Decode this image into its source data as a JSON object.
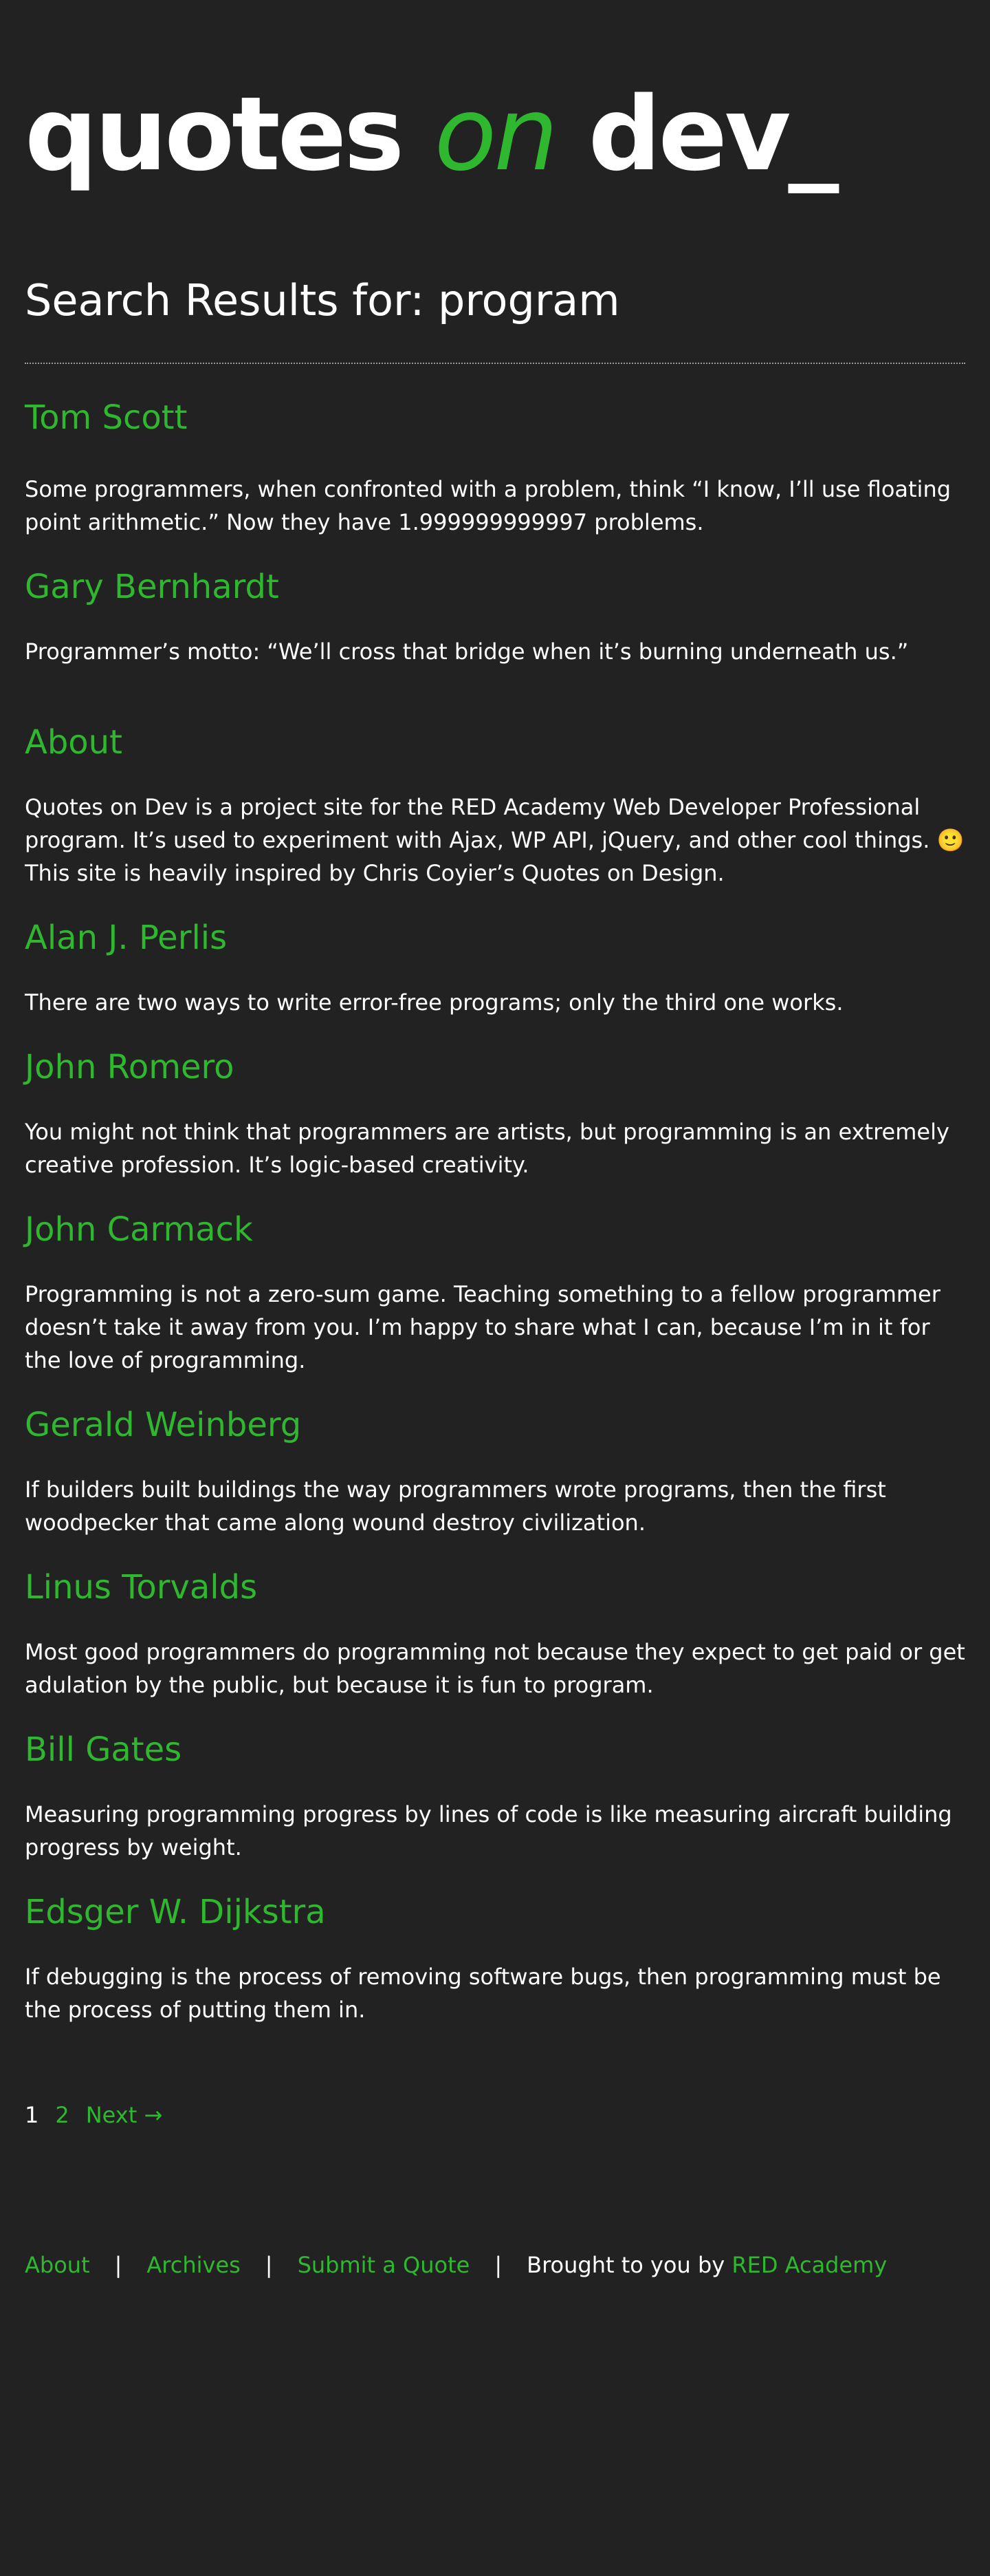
{
  "brand": {
    "logo_part1": "quotes ",
    "logo_part2": "on",
    "logo_part3": " dev_",
    "accent_color": "#2fb82f",
    "background_color": "#222222"
  },
  "search": {
    "title": "Search Results for: program"
  },
  "entries": [
    {
      "author": "Tom Scott",
      "text": "Some programmers, when confronted with a problem, think “I know, I’ll use floating point arithmetic.” Now they have 1.999999999997 problems."
    },
    {
      "author": "Gary Bernhardt",
      "text": "Programmer’s motto: “We’ll cross that bridge when it’s burning underneath us.”"
    },
    {
      "author": "About",
      "text": "Quotes on Dev is a project site for the RED Academy Web Developer Professional program. It’s used to experiment with Ajax, WP API, jQuery, and other cool things. 🙂 This site is heavily inspired by Chris Coyier’s Quotes on Design."
    },
    {
      "author": "Alan J. Perlis",
      "text": "There are two ways to write error-free programs; only the third one works."
    },
    {
      "author": "John Romero",
      "text": "You might not think that programmers are artists, but programming is an extremely creative profession. It’s logic-based creativity."
    },
    {
      "author": "John Carmack",
      "text": "Programming is not a zero-sum game. Teaching something to a fellow programmer doesn’t take it away from you. I’m happy to share what I can, because I’m in it for the love of programming."
    },
    {
      "author": "Gerald Weinberg",
      "text": "If builders built buildings the way programmers wrote programs, then the first woodpecker that came along wound destroy civilization."
    },
    {
      "author": "Linus Torvalds",
      "text": "Most good programmers do programming not because they expect to get paid or get adulation by the public, but because it is fun to program."
    },
    {
      "author": "Bill Gates",
      "text": "Measuring programming progress by lines of code is like measuring aircraft building progress by weight."
    },
    {
      "author": "Edsger W. Dijkstra",
      "text": "If debugging is the process of removing software bugs, then programming must be the process of putting them in."
    }
  ],
  "pagination": {
    "current": "1",
    "page2": "2",
    "next": "Next →"
  },
  "footer": {
    "about": "About",
    "archives": "Archives",
    "submit": "Submit a Quote",
    "separator": "|",
    "brought_by": "Brought to you by ",
    "red_academy": "RED Academy"
  }
}
